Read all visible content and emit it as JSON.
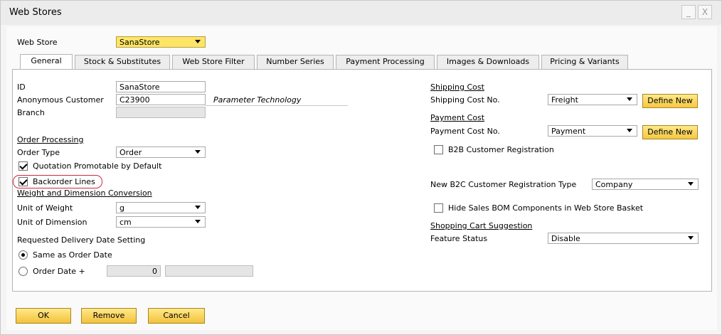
{
  "window": {
    "title": "Web Stores",
    "minimize": "_",
    "close": "X"
  },
  "header": {
    "web_store_label": "Web Store",
    "web_store_value": "SanaStore"
  },
  "tabs": [
    {
      "label": "General",
      "active": true
    },
    {
      "label": "Stock & Substitutes",
      "active": false
    },
    {
      "label": "Web Store Filter",
      "active": false
    },
    {
      "label": "Number Series",
      "active": false
    },
    {
      "label": "Payment Processing",
      "active": false
    },
    {
      "label": "Images & Downloads",
      "active": false
    },
    {
      "label": "Pricing & Variants",
      "active": false
    }
  ],
  "general": {
    "id_label": "ID",
    "id_value": "SanaStore",
    "anon_customer_label": "Anonymous Customer",
    "anon_customer_value": "C23900",
    "anon_customer_name": "Parameter Technology",
    "branch_label": "Branch",
    "branch_value": "",
    "order_processing_title": "Order Processing",
    "order_type_label": "Order Type",
    "order_type_value": "Order",
    "quotation_label": "Quotation Promotable by Default",
    "quotation_checked": true,
    "backorder_label": "Backorder Lines",
    "backorder_checked": true,
    "weight_dim_title": "Weight and Dimension Conversion",
    "unit_weight_label": "Unit of Weight",
    "unit_weight_value": "g",
    "unit_dim_label": "Unit of Dimension",
    "unit_dim_value": "cm",
    "delivery_title": "Requested Delivery Date Setting",
    "same_as_order_label": "Same as Order Date",
    "same_as_order_selected": true,
    "order_date_plus_label": "Order Date  +",
    "order_date_plus_selected": false,
    "order_date_plus_value": "0",
    "order_date_plus_unit": ""
  },
  "right": {
    "shipping_title": "Shipping Cost",
    "shipping_no_label": "Shipping Cost No.",
    "shipping_no_value": "Freight",
    "define_new_label": "Define New",
    "payment_title": "Payment Cost",
    "payment_no_label": "Payment Cost No.",
    "payment_no_value": "Payment",
    "b2b_label": "B2B Customer Registration",
    "b2b_checked": false,
    "b2c_type_label": "New B2C Customer Registration Type",
    "b2c_type_value": "Company",
    "hide_bom_label": "Hide Sales BOM Components in Web Store Basket",
    "hide_bom_checked": false,
    "cart_title": "Shopping Cart Suggestion",
    "feature_status_label": "Feature Status",
    "feature_status_value": "Disable"
  },
  "footer": {
    "ok_label": "OK",
    "remove_label": "Remove",
    "cancel_label": "Cancel"
  }
}
